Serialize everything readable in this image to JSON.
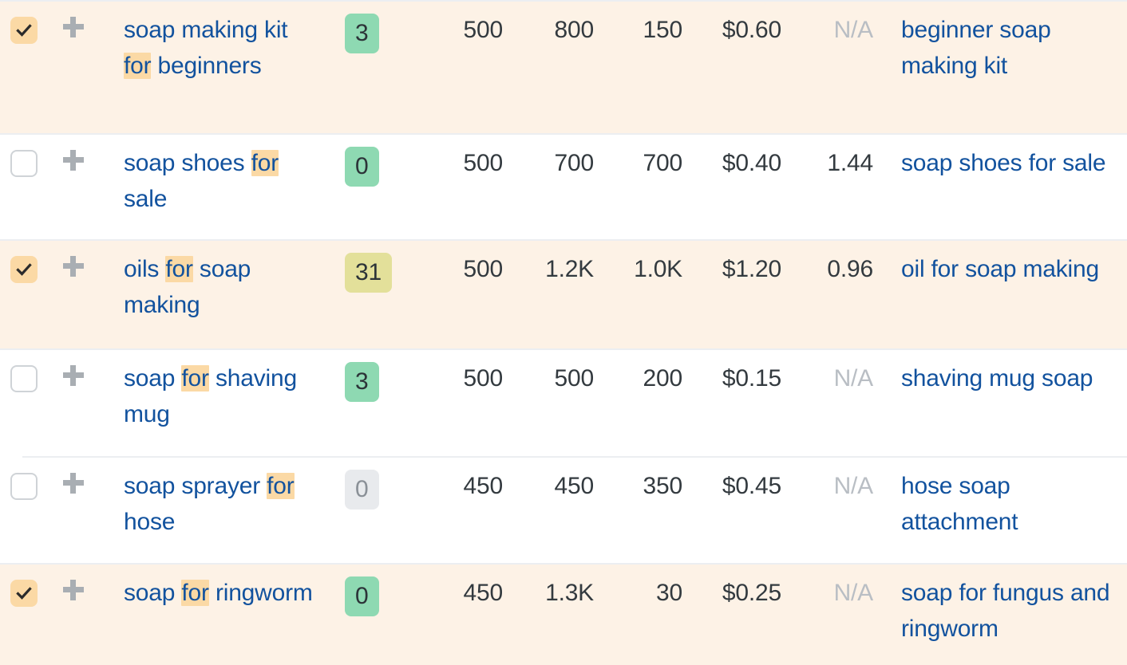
{
  "table": {
    "highlight_term": "for",
    "colors": {
      "selected_row_bg": "#fdf2e6",
      "link_text": "#12529e",
      "highlight_bg": "#fbd9a5",
      "badge_green": "#8ed9b2",
      "badge_yellow": "#e3e09a",
      "badge_grey": "#e8eaed",
      "na_text": "#b9bec4",
      "divider": "#eceef1",
      "plus_icon": "#a9aeb3",
      "checkbox_border": "#cfd3d7"
    },
    "icons": {
      "checkbox_checked": "checkbox-checked-icon",
      "checkbox_unchecked": "checkbox-unchecked-icon",
      "add_keyword": "plus-icon"
    },
    "rows": [
      {
        "selected": true,
        "checked": true,
        "keyword_parts": [
          {
            "text": "soap making kit ",
            "highlight": false
          },
          {
            "text": "for",
            "highlight": true
          },
          {
            "text": " beginners",
            "highlight": false
          }
        ],
        "keyword_plain": "soap making kit for beginners",
        "badge": {
          "value": "3",
          "tone": "green"
        },
        "volume": "500",
        "clicks": "800",
        "cpc_volume": "150",
        "cpc": "$0.60",
        "cps": "N/A",
        "cps_na": true,
        "parent_topic": "beginner soap making kit"
      },
      {
        "selected": false,
        "checked": false,
        "keyword_parts": [
          {
            "text": "soap shoes ",
            "highlight": false
          },
          {
            "text": "for",
            "highlight": true
          },
          {
            "text": " sale",
            "highlight": false
          }
        ],
        "keyword_plain": "soap shoes for sale",
        "badge": {
          "value": "0",
          "tone": "green"
        },
        "volume": "500",
        "clicks": "700",
        "cpc_volume": "700",
        "cpc": "$0.40",
        "cps": "1.44",
        "cps_na": false,
        "parent_topic": "soap shoes for sale"
      },
      {
        "selected": true,
        "checked": true,
        "keyword_parts": [
          {
            "text": "oils ",
            "highlight": false
          },
          {
            "text": "for",
            "highlight": true
          },
          {
            "text": " soap making",
            "highlight": false
          }
        ],
        "keyword_plain": "oils for soap making",
        "badge": {
          "value": "31",
          "tone": "yellow"
        },
        "volume": "500",
        "clicks": "1.2K",
        "cpc_volume": "1.0K",
        "cpc": "$1.20",
        "cps": "0.96",
        "cps_na": false,
        "parent_topic": "oil for soap making"
      },
      {
        "selected": false,
        "checked": false,
        "keyword_parts": [
          {
            "text": "soap ",
            "highlight": false
          },
          {
            "text": "for",
            "highlight": true
          },
          {
            "text": " shaving mug",
            "highlight": false
          }
        ],
        "keyword_plain": "soap for shaving mug",
        "badge": {
          "value": "3",
          "tone": "green"
        },
        "volume": "500",
        "clicks": "500",
        "cpc_volume": "200",
        "cpc": "$0.15",
        "cps": "N/A",
        "cps_na": true,
        "parent_topic": "shaving mug soap"
      },
      {
        "selected": false,
        "checked": false,
        "keyword_parts": [
          {
            "text": "soap sprayer ",
            "highlight": false
          },
          {
            "text": "for",
            "highlight": true
          },
          {
            "text": " hose",
            "highlight": false
          }
        ],
        "keyword_plain": "soap sprayer for hose",
        "badge": {
          "value": "0",
          "tone": "grey"
        },
        "volume": "450",
        "clicks": "450",
        "cpc_volume": "350",
        "cpc": "$0.45",
        "cps": "N/A",
        "cps_na": true,
        "parent_topic": "hose soap attachment"
      },
      {
        "selected": true,
        "checked": true,
        "keyword_parts": [
          {
            "text": "soap ",
            "highlight": false
          },
          {
            "text": "for",
            "highlight": true
          },
          {
            "text": " ringworm",
            "highlight": false
          }
        ],
        "keyword_plain": "soap for ringworm",
        "badge": {
          "value": "0",
          "tone": "green"
        },
        "volume": "450",
        "clicks": "1.3K",
        "cpc_volume": "30",
        "cpc": "$0.25",
        "cps": "N/A",
        "cps_na": true,
        "parent_topic": "soap for fungus and ringworm"
      }
    ]
  }
}
